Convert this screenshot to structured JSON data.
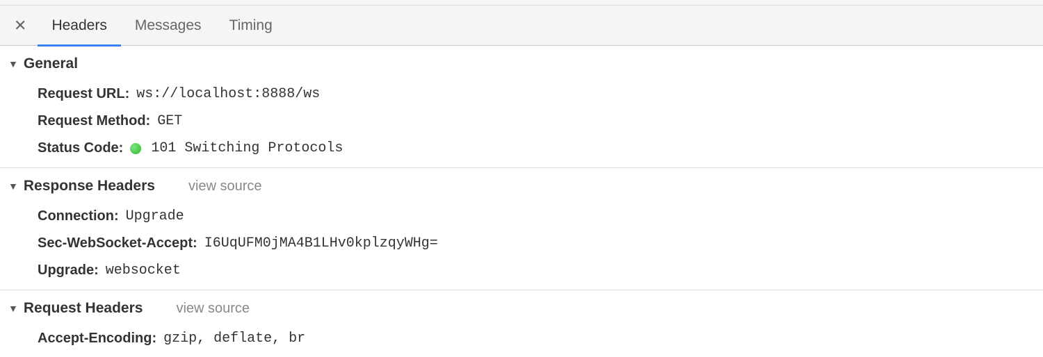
{
  "tabs": {
    "headers": "Headers",
    "messages": "Messages",
    "timing": "Timing"
  },
  "sections": {
    "general": {
      "title": "General",
      "request_url_label": "Request URL:",
      "request_url_value": "ws://localhost:8888/ws",
      "request_method_label": "Request Method:",
      "request_method_value": "GET",
      "status_code_label": "Status Code:",
      "status_code_value": "101 Switching Protocols"
    },
    "response_headers": {
      "title": "Response Headers",
      "view_source": "view source",
      "connection_label": "Connection:",
      "connection_value": "Upgrade",
      "sec_websocket_accept_label": "Sec-WebSocket-Accept:",
      "sec_websocket_accept_value": "I6UqUFM0jMA4B1LHv0kplzqyWHg=",
      "upgrade_label": "Upgrade:",
      "upgrade_value": "websocket"
    },
    "request_headers": {
      "title": "Request Headers",
      "view_source": "view source",
      "accept_encoding_label": "Accept-Encoding:",
      "accept_encoding_value": "gzip, deflate, br"
    }
  }
}
